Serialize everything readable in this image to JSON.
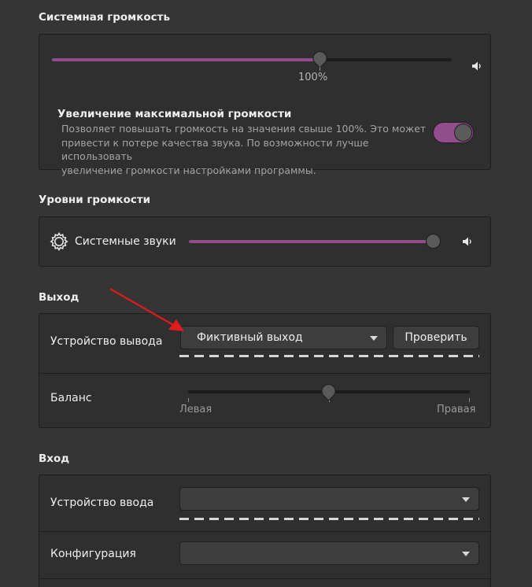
{
  "system_volume": {
    "title": "Системная громкость",
    "value_label": "100%",
    "level_fraction": 0.67,
    "over_amplification": {
      "title": "Увеличение максимальной громкости",
      "description_lines": [
        "Позволяет повышать громкость на значения свыше 100%. Это может",
        "привести к потере качества звука. По возможности лучше использовать",
        "увеличение громкости настройками программы."
      ],
      "enabled": true
    },
    "speaker_icon": "speaker-icon"
  },
  "volume_levels": {
    "title": "Уровни громкости",
    "system_sounds": {
      "label": "Системные звуки",
      "icon": "gear-icon",
      "level_fraction": 1.0
    }
  },
  "output": {
    "title": "Выход",
    "device_label": "Устройство вывода",
    "device_value": "Фиктивный выход",
    "test_button": "Проверить",
    "balance_label": "Баланс",
    "balance_left": "Левая",
    "balance_right": "Правая",
    "balance_fraction": 0.5
  },
  "input": {
    "title": "Вход",
    "device_label": "Устройство ввода",
    "device_value": "",
    "config_label": "Конфигурация",
    "config_value": ""
  },
  "colors": {
    "accent": "#924d8b",
    "annotation_arrow": "#e01b1b"
  }
}
